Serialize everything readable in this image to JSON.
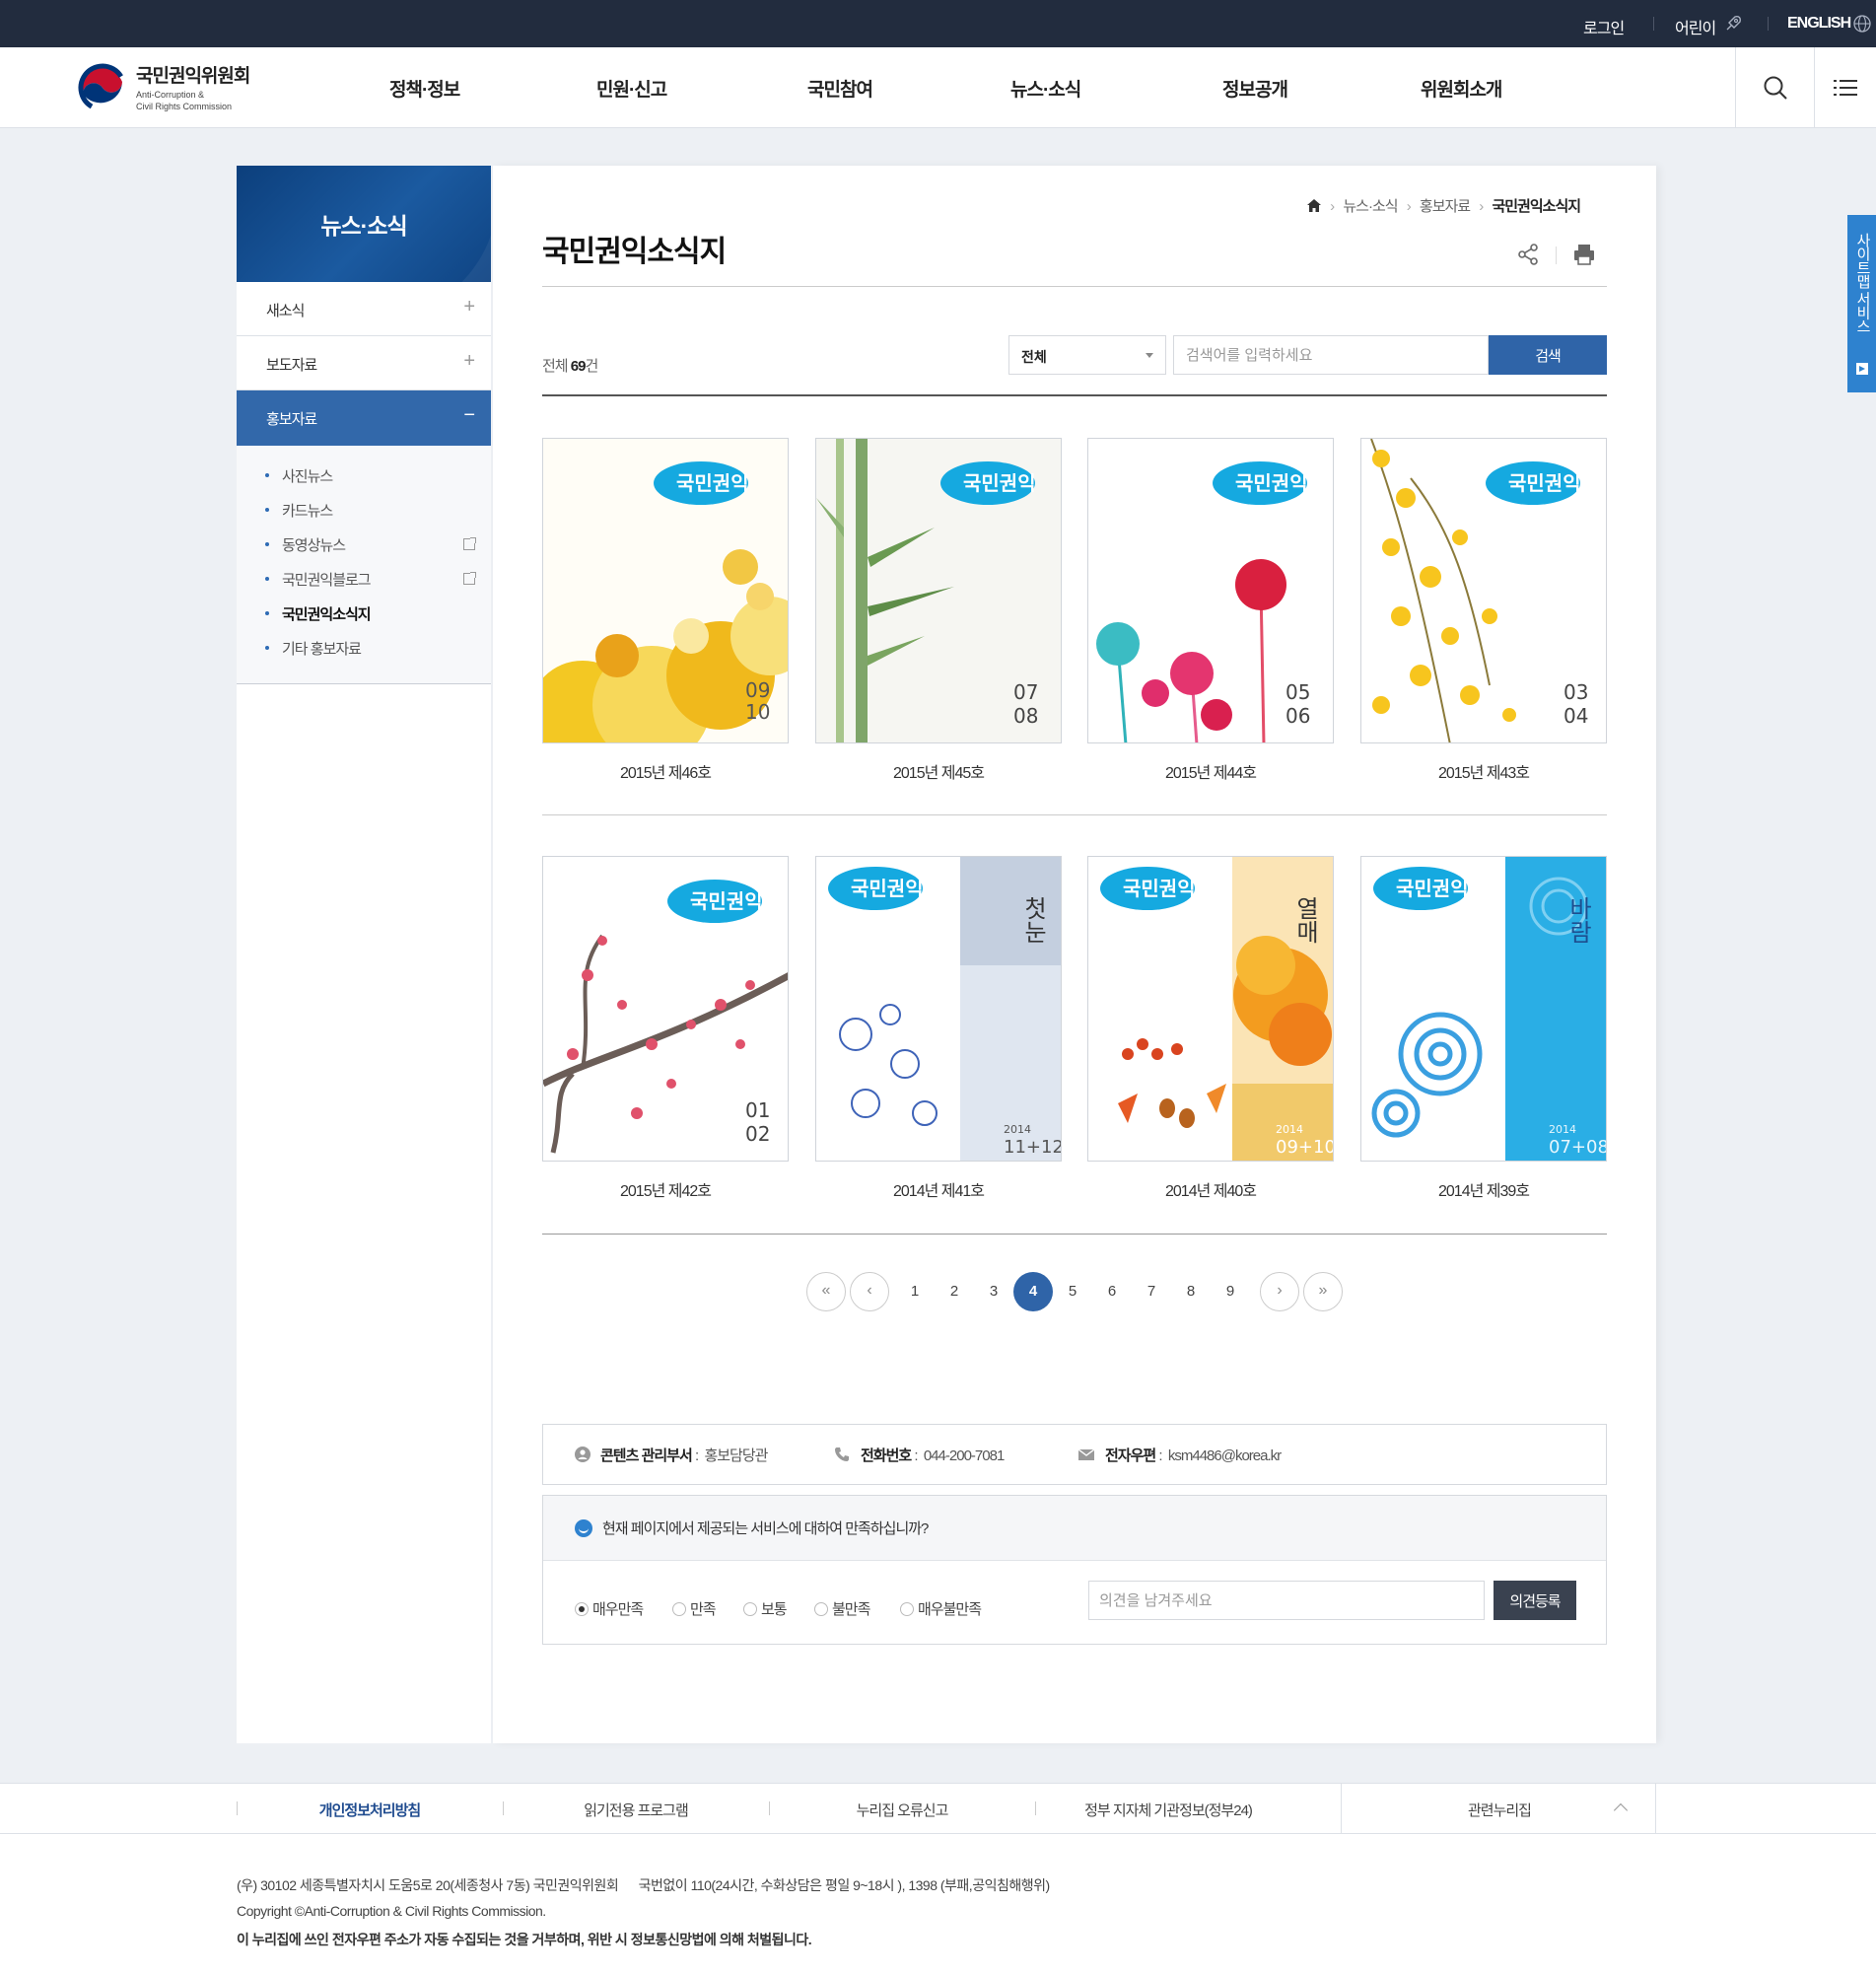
{
  "utility": {
    "login": "로그인",
    "kids": "어린이",
    "english": "ENGLISH"
  },
  "header": {
    "logo_ko": "국민권익위원회",
    "logo_en_1": "Anti-Corruption &",
    "logo_en_2": "Civil Rights Commission",
    "nav": [
      "정책·정보",
      "민원·신고",
      "국민참여",
      "뉴스·소식",
      "정보공개",
      "위원회소개"
    ]
  },
  "side_tab": {
    "label": "사이트맵 서비스"
  },
  "lnb": {
    "title": "뉴스·소식",
    "menus": [
      {
        "label": "새소식",
        "toggle": "+"
      },
      {
        "label": "보도자료",
        "toggle": "+"
      },
      {
        "label": "홍보자료",
        "toggle": "−"
      }
    ],
    "submenu": [
      "사진뉴스",
      "카드뉴스",
      "동영상뉴스",
      "국민권익블로그",
      "국민권익소식지",
      "기타 홍보자료"
    ]
  },
  "content": {
    "breadcrumb": [
      "뉴스·소식",
      "홍보자료",
      "국민권익소식지"
    ],
    "title": "국민권익소식지",
    "total_prefix": "전체",
    "total_count": "69",
    "total_suffix": "건",
    "search": {
      "select_value": "전체",
      "placeholder": "검색어를 입력하세요",
      "button": "검색"
    },
    "items": [
      {
        "label": "2015년 제46호",
        "issue_top": "09",
        "issue_bottom": "10",
        "year": "2015",
        "theme": "ginkgo"
      },
      {
        "label": "2015년 제45호",
        "issue_top": "07",
        "issue_bottom": "08",
        "year": "2015",
        "theme": "bamboo"
      },
      {
        "label": "2015년 제44호",
        "issue_top": "05",
        "issue_bottom": "06",
        "year": "2015",
        "theme": "flowers"
      },
      {
        "label": "2015년 제43호",
        "issue_top": "03",
        "issue_bottom": "04",
        "year": "2015",
        "theme": "forsythia"
      },
      {
        "label": "2015년 제42호",
        "issue_top": "01",
        "issue_bottom": "02",
        "year": "2015",
        "theme": "plum"
      },
      {
        "label": "2014년 제41호",
        "issue_top": "2014",
        "issue_bottom": "11+12",
        "year": "2014",
        "theme": "snow",
        "side_text": "첫눈"
      },
      {
        "label": "2014년 제40호",
        "issue_top": "2014",
        "issue_bottom": "09+10",
        "year": "2014",
        "theme": "autumn",
        "side_text": "열매"
      },
      {
        "label": "2014년 제39호",
        "issue_top": "2014",
        "issue_bottom": "07+08",
        "year": "2014",
        "theme": "wind",
        "side_text": "바람"
      }
    ],
    "cover_logo": "국민권익",
    "pagination": {
      "pages": [
        "1",
        "2",
        "3",
        "4",
        "5",
        "6",
        "7",
        "8",
        "9"
      ],
      "current": "4"
    },
    "info": {
      "dept_label": "콘텐츠 관리부서",
      "dept_value": "홍보담당관",
      "phone_label": "전화번호",
      "phone_value": "044-200-7081",
      "email_label": "전자우편",
      "email_value": "ksm4486@korea.kr"
    },
    "survey": {
      "question": "현재 페이지에서 제공되는 서비스에 대하여 만족하십니까?",
      "options": [
        "매우만족",
        "만족",
        "보통",
        "불만족",
        "매우불만족"
      ],
      "selected": "매우만족",
      "placeholder": "의견을 남겨주세요",
      "button": "의견등록"
    }
  },
  "footer": {
    "links": [
      "개인정보처리방침",
      "읽기전용 프로그램",
      "누리집 오류신고",
      "정부 지자체 기관정보(정부24)"
    ],
    "related": "관련누리집",
    "address": "(우) 30102 세종특별자치시 도움5로 20(세종청사 7동) 국민권익위원회",
    "call": "국번없이 110(24시간, 수화상담은 평일 9~18시 ), 1398 (부패,공익침해행위)",
    "copyright": "Copyright ©Anti-Corruption & Civil Rights Commission.",
    "notice": "이 누리집에 쓰인 전자우편 주소가 자동 수집되는 것을 거부하며, 위반 시 정보통신망법에 의해 처벌됩니다."
  },
  "colors": {
    "topbar": "#222c3e",
    "primary": "#2f64a8",
    "lnb_active": "#3268aa",
    "side_tab": "#2e82cf"
  }
}
